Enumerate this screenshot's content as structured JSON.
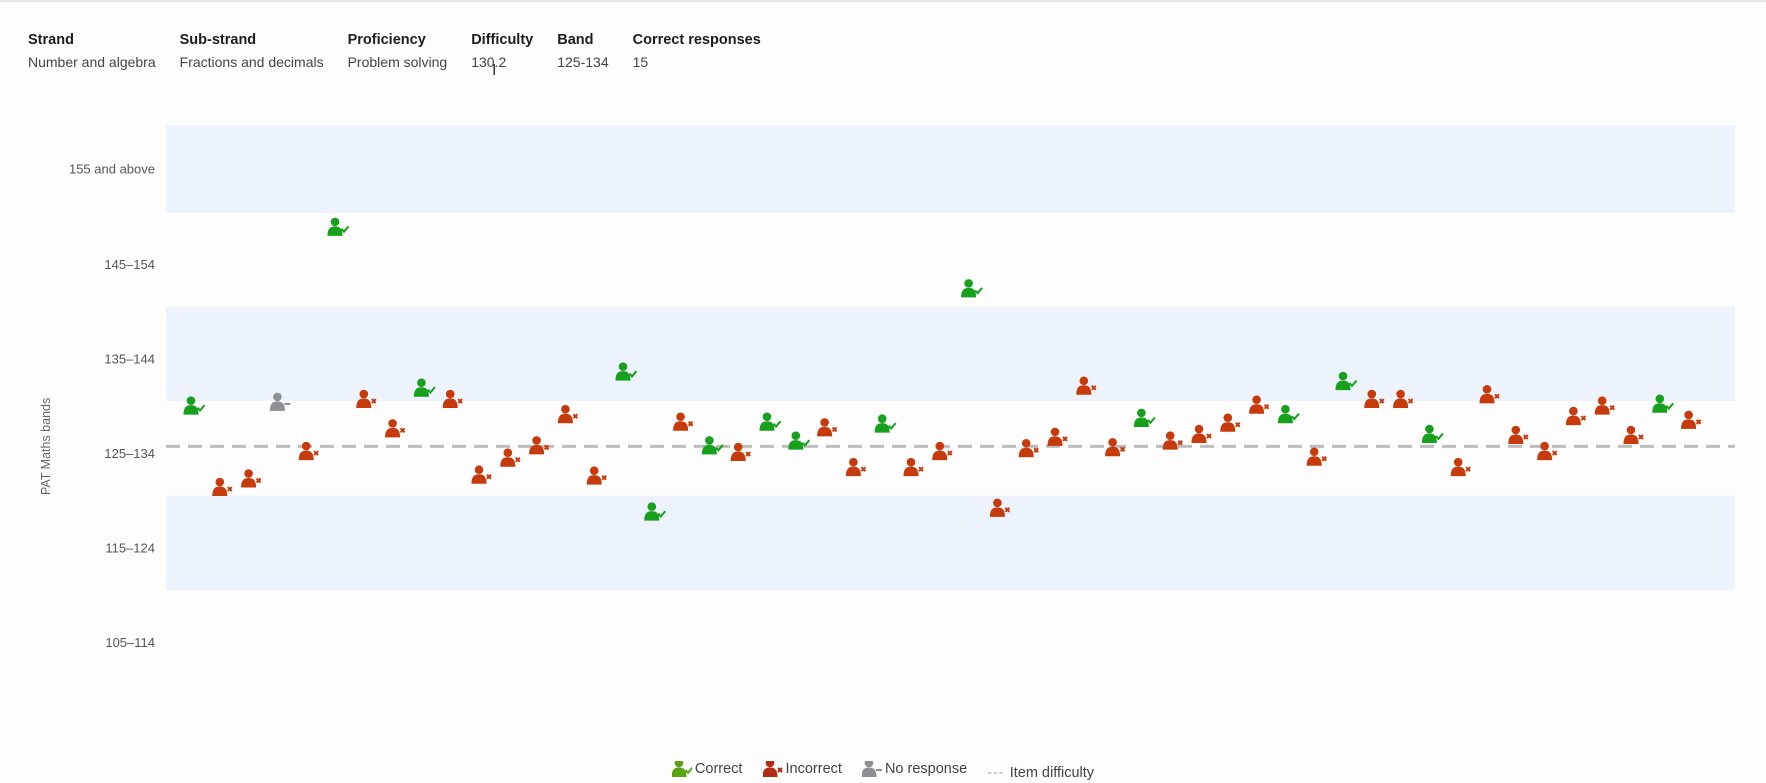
{
  "meta": [
    {
      "key": "Strand",
      "value": "Number and algebra"
    },
    {
      "key": "Sub-strand",
      "value": "Fractions and decimals"
    },
    {
      "key": "Proficiency",
      "value": "Problem solving"
    },
    {
      "key": "Difficulty",
      "value": "130.2"
    },
    {
      "key": "Band",
      "value": "125-134"
    },
    {
      "key": "Correct responses",
      "value": "15"
    }
  ],
  "colors": {
    "correct": "#16a01c",
    "incorrect": "#c73a0c",
    "no_response": "#8f8f94",
    "band_fill": "#edf3fd",
    "difficulty_line": "#bdbdbd"
  },
  "legend": {
    "correct": "Correct",
    "incorrect": "Incorrect",
    "no_response": "No response",
    "item_difficulty": "Item difficulty"
  },
  "chart_data": {
    "type": "scatter",
    "title": "",
    "xlabel": "",
    "ylabel": "PAT Maths bands",
    "ylim": [
      105,
      165
    ],
    "bands": [
      "155 and above",
      "145–154",
      "135–144",
      "125–134",
      "115–124",
      "105–114"
    ],
    "item_difficulty": 130.2,
    "legend_position": "bottom",
    "students": [
      {
        "score": 134.4,
        "result": "correct"
      },
      {
        "score": 125.8,
        "result": "incorrect"
      },
      {
        "score": 126.7,
        "result": "incorrect"
      },
      {
        "score": 134.8,
        "result": "no_response"
      },
      {
        "score": 129.6,
        "result": "incorrect"
      },
      {
        "score": 153.3,
        "result": "correct"
      },
      {
        "score": 135.1,
        "result": "incorrect"
      },
      {
        "score": 132.0,
        "result": "incorrect"
      },
      {
        "score": 136.3,
        "result": "correct"
      },
      {
        "score": 135.1,
        "result": "incorrect"
      },
      {
        "score": 127.1,
        "result": "incorrect"
      },
      {
        "score": 128.9,
        "result": "incorrect"
      },
      {
        "score": 130.2,
        "result": "incorrect"
      },
      {
        "score": 133.5,
        "result": "incorrect"
      },
      {
        "score": 127.0,
        "result": "incorrect"
      },
      {
        "score": 138.0,
        "result": "correct"
      },
      {
        "score": 123.2,
        "result": "correct"
      },
      {
        "score": 132.7,
        "result": "incorrect"
      },
      {
        "score": 130.2,
        "result": "correct"
      },
      {
        "score": 129.5,
        "result": "incorrect"
      },
      {
        "score": 132.7,
        "result": "correct"
      },
      {
        "score": 130.7,
        "result": "correct"
      },
      {
        "score": 132.1,
        "result": "incorrect"
      },
      {
        "score": 127.9,
        "result": "incorrect"
      },
      {
        "score": 132.5,
        "result": "correct"
      },
      {
        "score": 127.9,
        "result": "incorrect"
      },
      {
        "score": 129.6,
        "result": "incorrect"
      },
      {
        "score": 146.8,
        "result": "correct"
      },
      {
        "score": 123.6,
        "result": "incorrect"
      },
      {
        "score": 129.9,
        "result": "incorrect"
      },
      {
        "score": 131.1,
        "result": "incorrect"
      },
      {
        "score": 136.5,
        "result": "incorrect"
      },
      {
        "score": 130.0,
        "result": "incorrect"
      },
      {
        "score": 133.1,
        "result": "correct"
      },
      {
        "score": 130.7,
        "result": "incorrect"
      },
      {
        "score": 131.4,
        "result": "incorrect"
      },
      {
        "score": 132.6,
        "result": "incorrect"
      },
      {
        "score": 134.5,
        "result": "incorrect"
      },
      {
        "score": 133.5,
        "result": "correct"
      },
      {
        "score": 129.0,
        "result": "incorrect"
      },
      {
        "score": 137.0,
        "result": "correct"
      },
      {
        "score": 135.1,
        "result": "incorrect"
      },
      {
        "score": 135.1,
        "result": "incorrect"
      },
      {
        "score": 131.4,
        "result": "correct"
      },
      {
        "score": 127.9,
        "result": "incorrect"
      },
      {
        "score": 135.6,
        "result": "incorrect"
      },
      {
        "score": 131.3,
        "result": "incorrect"
      },
      {
        "score": 129.6,
        "result": "incorrect"
      },
      {
        "score": 133.3,
        "result": "incorrect"
      },
      {
        "score": 134.4,
        "result": "incorrect"
      },
      {
        "score": 131.3,
        "result": "incorrect"
      },
      {
        "score": 134.6,
        "result": "correct"
      },
      {
        "score": 132.9,
        "result": "incorrect"
      }
    ]
  }
}
